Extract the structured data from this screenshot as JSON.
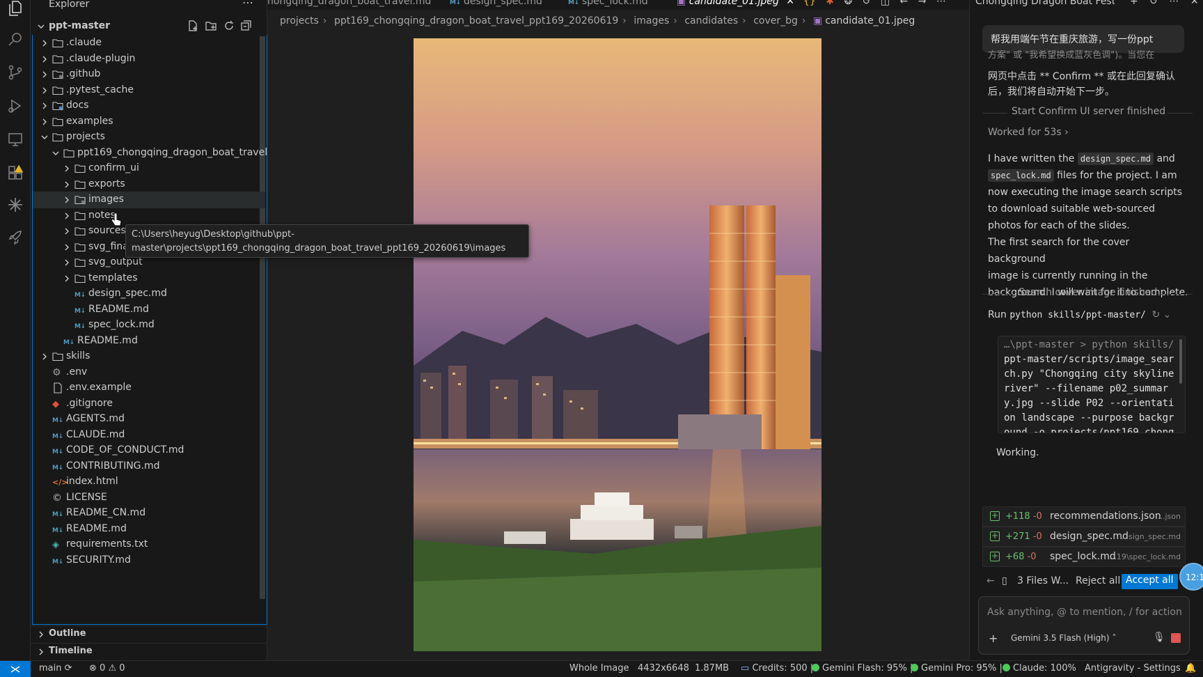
{
  "explorer": {
    "title": "Explorer",
    "root": "ppt-master",
    "items": [
      {
        "label": ".claude",
        "kind": "folder"
      },
      {
        "label": ".claude-plugin",
        "kind": "folder"
      },
      {
        "label": ".github",
        "kind": "folder"
      },
      {
        "label": ".pytest_cache",
        "kind": "folder"
      },
      {
        "label": "docs",
        "kind": "folder"
      },
      {
        "label": "examples",
        "kind": "folder"
      },
      {
        "label": "projects",
        "kind": "folder"
      },
      {
        "label": "ppt169_chongqing_dragon_boat_travel_...",
        "kind": "folder"
      },
      {
        "label": "confirm_ui",
        "kind": "folder"
      },
      {
        "label": "exports",
        "kind": "folder"
      },
      {
        "label": "images",
        "kind": "folder"
      },
      {
        "label": "notes",
        "kind": "folder"
      },
      {
        "label": "sources",
        "kind": "folder"
      },
      {
        "label": "svg_final",
        "kind": "folder"
      },
      {
        "label": "svg_output",
        "kind": "folder"
      },
      {
        "label": "templates",
        "kind": "folder"
      },
      {
        "label": "design_spec.md",
        "kind": "md"
      },
      {
        "label": "README.md",
        "kind": "md"
      },
      {
        "label": "spec_lock.md",
        "kind": "md"
      },
      {
        "label": "README.md",
        "kind": "md"
      },
      {
        "label": "skills",
        "kind": "folder"
      },
      {
        "label": ".env",
        "kind": "gear"
      },
      {
        "label": ".env.example",
        "kind": "file"
      },
      {
        "label": ".gitignore",
        "kind": "git"
      },
      {
        "label": "AGENTS.md",
        "kind": "md"
      },
      {
        "label": "CLAUDE.md",
        "kind": "md"
      },
      {
        "label": "CODE_OF_CONDUCT.md",
        "kind": "md"
      },
      {
        "label": "CONTRIBUTING.md",
        "kind": "md"
      },
      {
        "label": "index.html",
        "kind": "html"
      },
      {
        "label": "LICENSE",
        "kind": "license"
      },
      {
        "label": "README_CN.md",
        "kind": "md"
      },
      {
        "label": "README.md",
        "kind": "md"
      },
      {
        "label": "requirements.txt",
        "kind": "python"
      },
      {
        "label": "SECURITY.md",
        "kind": "md"
      }
    ],
    "tooltip_line1": "C:\\Users\\heyug\\Desktop\\github\\ppt-",
    "tooltip_line2": "master\\projects\\ppt169_chongqing_dragon_boat_travel_ppt169_20260619\\images",
    "outline": "Outline",
    "timeline": "Timeline"
  },
  "tabs": [
    {
      "label": "hongqing_dragon_boat_travel.md"
    },
    {
      "label": "design_spec.md"
    },
    {
      "label": "spec_lock.md"
    },
    {
      "label": "candidate_01.jpeg"
    }
  ],
  "breadcrumb": [
    "projects",
    "ppt169_chongqing_dragon_boat_travel_ppt169_20260619",
    "images",
    "candidates",
    "cover_bg",
    "candidate_01.jpeg"
  ],
  "chat": {
    "title": "Chongqing Dragon Boat Festiva",
    "user_message": "帮我用端午节在重庆旅游，写一份ppt",
    "partial_line": "方案\" 或 \"我希望换成蓝灰色调\")。当您在",
    "line2": "网页中点击 ** Confirm ** 或在此回复确认",
    "line3": "后，我们将自动开始下一步。",
    "confirm_finished": "Start Confirm UI server finished",
    "worked_for": "Worked for 53s",
    "p1_a": "I have written the",
    "p1_code1": "design_spec.md",
    "p1_b": "and",
    "p1_code2": "spec_lock.md",
    "p1_c": "files for the project. I am",
    "p1_d": "now executing the image search scripts",
    "p1_e": "to download suitable web-sourced",
    "p1_f": "photos for each of the slides.",
    "p2_a": "The first search for the cover background",
    "p2_b": "image is currently running in the",
    "p2_c": "background. I will wait for it to complete.",
    "search_finished": "Search cover image finished",
    "run_label": "Run",
    "run_cmd": "python skills/ppt-master/",
    "code_lines": [
      "…\\ppt-master > python skills/",
      "ppt-master/scripts/image_sear",
      "ch.py \"Chongqing city skyline",
      "river\" --filename p02_summar",
      "y.jpg --slide P02 --orientati",
      "on landscape --purpose backgr",
      "ound -o projects/ppt169_chong"
    ],
    "working": "Working.",
    "files": [
      {
        "add": "+118",
        "del": "-0",
        "name": "recommendations.json",
        "path": "...json"
      },
      {
        "add": "+271",
        "del": "-0",
        "name": "design_spec.md",
        "path": "...sign_spec.md"
      },
      {
        "add": "+68",
        "del": "-0",
        "name": "spec_lock.md",
        "path": "...19\\spec_lock.md"
      }
    ],
    "files_count": "3 Files W...",
    "reject_all": "Reject all",
    "accept_all": "Accept all",
    "input_placeholder": "Ask anything, @ to mention, / for actions",
    "model": "Gemini 3.5 Flash (High)",
    "timer": "12:1"
  },
  "status": {
    "branch": "main",
    "errors": "0",
    "warnings": "0",
    "view_mode": "Whole Image",
    "dimensions": "4432x6648",
    "size": "1.87MB",
    "credits": "Credits: 500 |",
    "gemini_flash": "Gemini Flash: 95% |",
    "gemini_pro": "Gemini Pro: 95% |",
    "claude": "Claude: 100%",
    "settings": "Antigravity - Settings"
  },
  "colors": {
    "accent": "#0078d4",
    "added": "#6cc070",
    "deleted": "#e06c6c",
    "quota_dot": "#4ec95b"
  }
}
